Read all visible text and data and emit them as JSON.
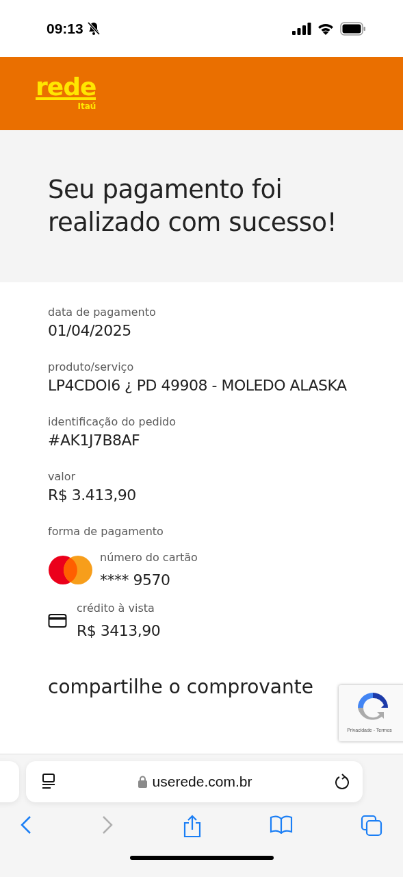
{
  "status_bar": {
    "time": "09:13",
    "silent": true
  },
  "header": {
    "logo": "rede",
    "logo_sub": "Itaú"
  },
  "hero": {
    "title": "Seu pagamento foi realizado com sucesso!"
  },
  "details": [
    {
      "label": "data de pagamento",
      "value": "01/04/2025"
    },
    {
      "label": "produto/serviço",
      "value": "LP4CDOI6 ¿ PD 49908 - MOLEDO ALASKA"
    },
    {
      "label": "identificação do pedido",
      "value": "#AK1J7B8AF"
    },
    {
      "label": "valor",
      "value": "R$ 3.413,90"
    }
  ],
  "payment": {
    "label": "forma de pagamento",
    "items": [
      {
        "kind": "card_brand",
        "label": "número do cartão",
        "value": "**** 9570"
      },
      {
        "kind": "card",
        "label": "crédito à vista",
        "value": "R$ 3413,90"
      }
    ]
  },
  "share_heading": "compartilhe o comprovante",
  "recaptcha": {
    "links": "Privacidade - Termos"
  },
  "browser": {
    "url": "userede.com.br",
    "back_disabled": false,
    "forward_disabled": true
  }
}
